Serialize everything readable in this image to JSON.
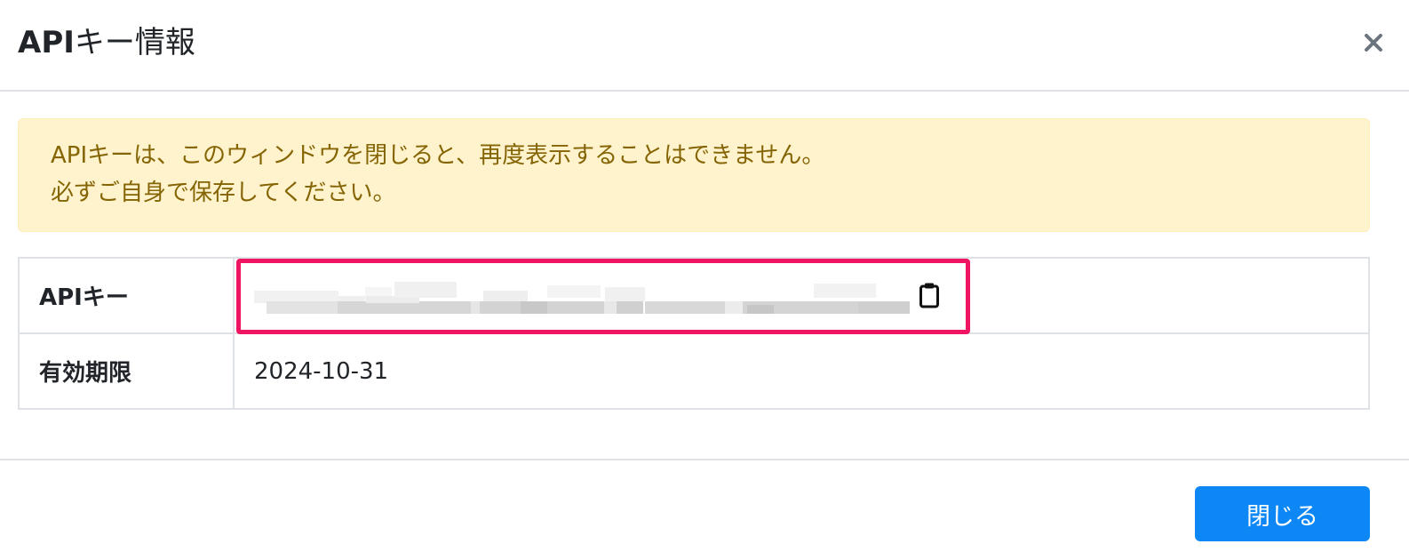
{
  "modal": {
    "title_bold": "API",
    "title_rest": "キー情報",
    "close_icon": "close-icon"
  },
  "alert": {
    "line1": "APIキーは、このウィンドウを閉じると、再度表示することはできません。",
    "line2": "必ずご自身で保存してください。"
  },
  "table": {
    "rows": [
      {
        "label": "APIキー",
        "value": "",
        "masked": true,
        "copy_icon": "clipboard-icon"
      },
      {
        "label": "有効期限",
        "value": "2024-10-31"
      }
    ]
  },
  "footer": {
    "close_label": "閉じる"
  },
  "colors": {
    "alert_bg": "#fff3cd",
    "alert_text": "#856404",
    "highlight": "#ef1563",
    "primary_button": "#0d87f5"
  }
}
